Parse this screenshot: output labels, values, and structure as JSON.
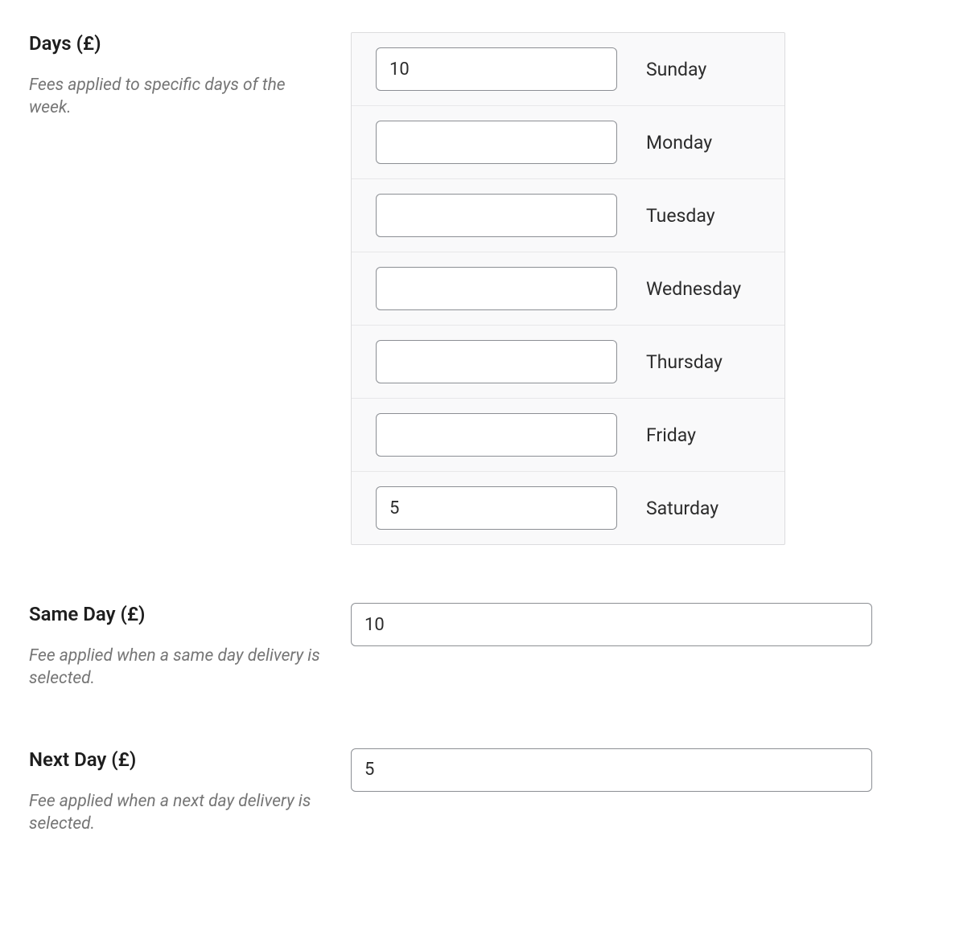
{
  "days_section": {
    "title": "Days (£)",
    "description": "Fees applied to specific days of the week.",
    "rows": [
      {
        "value": "10",
        "label": "Sunday"
      },
      {
        "value": "",
        "label": "Monday"
      },
      {
        "value": "",
        "label": "Tuesday"
      },
      {
        "value": "",
        "label": "Wednesday"
      },
      {
        "value": "",
        "label": "Thursday"
      },
      {
        "value": "",
        "label": "Friday"
      },
      {
        "value": "5",
        "label": "Saturday"
      }
    ]
  },
  "same_day_section": {
    "title": "Same Day (£)",
    "description": "Fee applied when a same day delivery is selected.",
    "value": "10"
  },
  "next_day_section": {
    "title": "Next Day (£)",
    "description": "Fee applied when a next day delivery is selected.",
    "value": "5"
  }
}
